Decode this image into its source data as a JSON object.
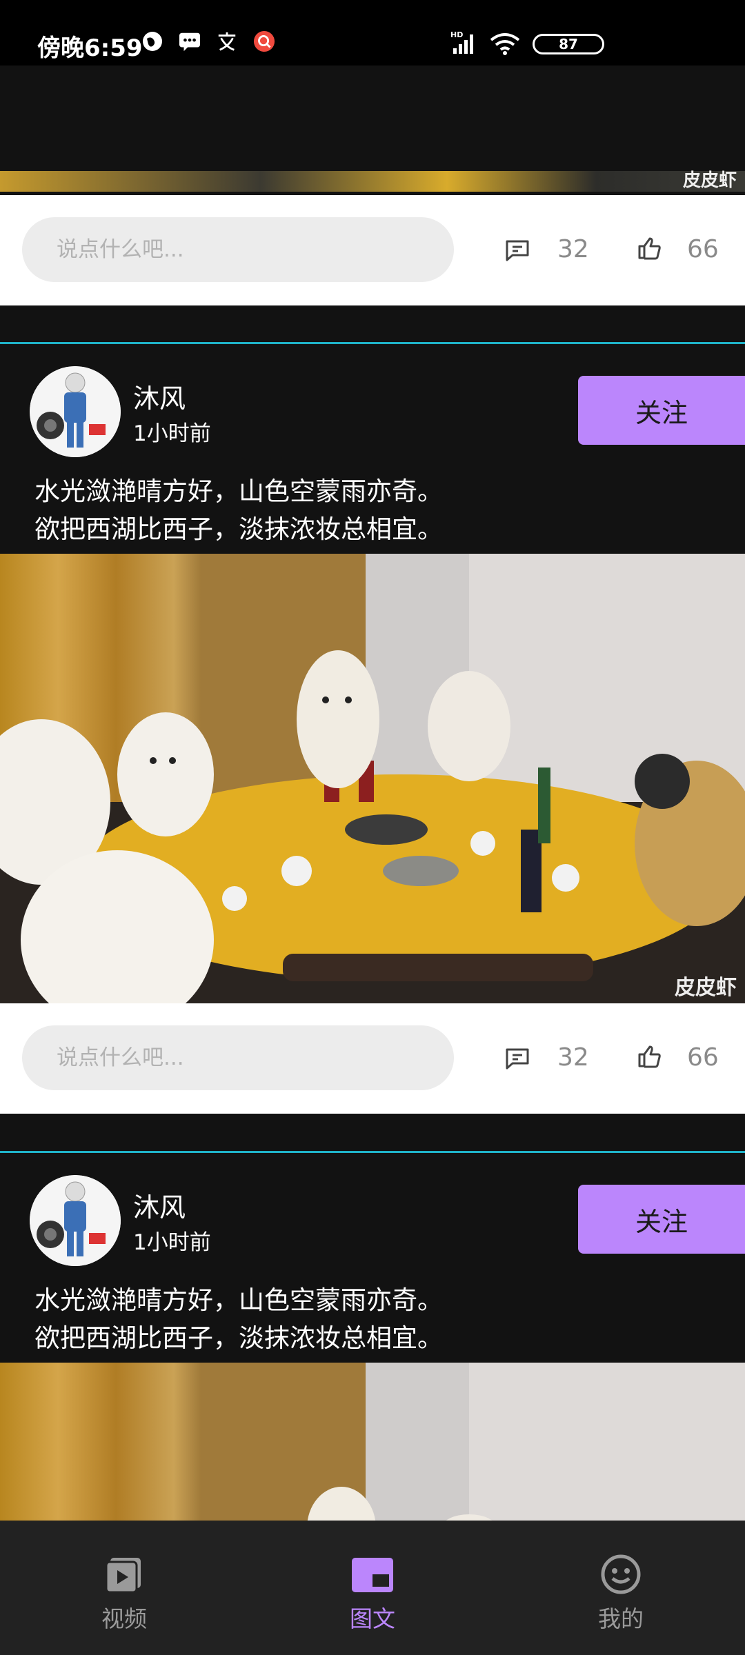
{
  "status_bar": {
    "time": "傍晚6:59",
    "network": "HD",
    "battery": "87"
  },
  "feed": {
    "comment_placeholder": "说点什么吧...",
    "posts": [
      {
        "comments": "32",
        "likes": "66",
        "image_watermark": "皮皮虾"
      },
      {
        "author": "沐风",
        "time": "1小时前",
        "follow_label": "关注",
        "text_line1": "水光潋滟晴方好，山色空蒙雨亦奇。",
        "text_line2": "欲把西湖比西子，淡抹浓妆总相宜。",
        "image_watermark": "皮皮虾",
        "comments": "32",
        "likes": "66"
      },
      {
        "author": "沐风",
        "time": "1小时前",
        "follow_label": "关注",
        "text_line1": "水光潋滟晴方好，山色空蒙雨亦奇。",
        "text_line2": "欲把西湖比西子，淡抹浓妆总相宜。"
      }
    ]
  },
  "bottom_nav": {
    "items": [
      {
        "label": "视频",
        "icon": "video-icon"
      },
      {
        "label": "图文",
        "icon": "image-text-icon",
        "active": true
      },
      {
        "label": "我的",
        "icon": "face-icon"
      }
    ]
  },
  "colors": {
    "accent": "#bb86fc",
    "divider": "#1fb3c8",
    "background": "#121212"
  }
}
